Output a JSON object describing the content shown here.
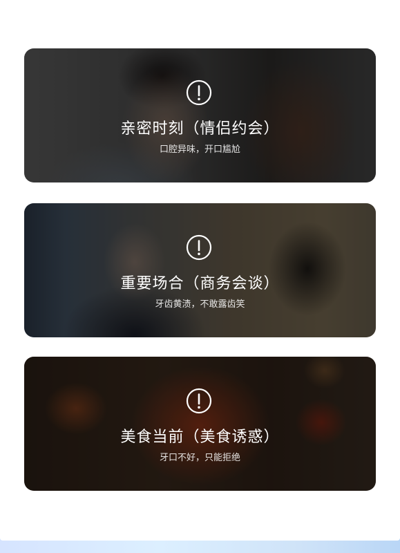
{
  "cards": [
    {
      "icon": "alert-circle-icon",
      "title": "亲密时刻（情侣约会）",
      "subtitle": "口腔异味，开口尴尬",
      "image": "couple-kissing-photo"
    },
    {
      "icon": "alert-circle-icon",
      "title": "重要场合（商务会谈）",
      "subtitle": "牙齿黄渍，不敢露齿笑",
      "image": "business-meeting-photo"
    },
    {
      "icon": "alert-circle-icon",
      "title": "美食当前（美食诱惑）",
      "subtitle": "牙口不好，只能拒绝",
      "image": "hotpot-food-photo"
    }
  ],
  "colors": {
    "overlay": "#000000",
    "text": "#ffffff",
    "bottom_bar_start": "#d6e4ff",
    "bottom_bar_end": "#b9d6f6"
  }
}
